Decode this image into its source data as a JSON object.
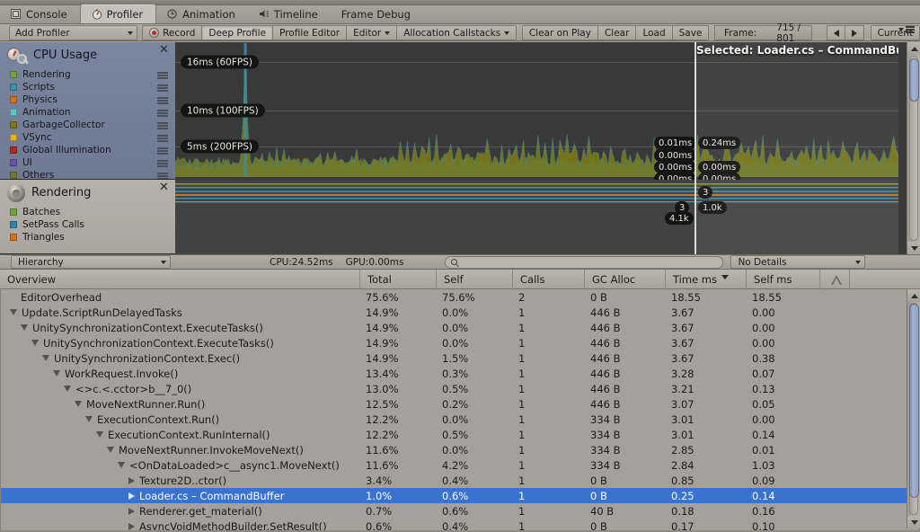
{
  "window": {
    "tabs": [
      {
        "label": "Console",
        "icon": "console-icon",
        "active": false
      },
      {
        "label": "Profiler",
        "icon": "profiler-icon",
        "active": true
      },
      {
        "label": "Animation",
        "icon": "clock-icon",
        "active": false
      },
      {
        "label": "Timeline",
        "icon": "timeline-icon",
        "active": false
      },
      {
        "label": "Frame Debug",
        "icon": "none",
        "active": false
      }
    ]
  },
  "toolbar": {
    "add_profiler": "Add Profiler",
    "record": "Record",
    "deep_profile": "Deep Profile",
    "profile_editor": "Profile Editor",
    "editor": "Editor",
    "allocation_callstacks": "Allocation Callstacks",
    "clear_on_play": "Clear on Play",
    "clear": "Clear",
    "load": "Load",
    "save": "Save",
    "frame_label": "Frame:",
    "frame_value": "715 / 801",
    "current": "Current"
  },
  "modules": [
    {
      "title": "CPU Usage",
      "icon": "cpu-usage-icon",
      "rows": [
        {
          "label": "Rendering",
          "color": "#73a13c"
        },
        {
          "label": "Scripts",
          "color": "#3b90a8"
        },
        {
          "label": "Physics",
          "color": "#d2711f"
        },
        {
          "label": "Animation",
          "color": "#63c6c0"
        },
        {
          "label": "GarbageCollector",
          "color": "#7d7717"
        },
        {
          "label": "VSync",
          "color": "#e3b320"
        },
        {
          "label": "Global Illumination",
          "color": "#ab2b18"
        },
        {
          "label": "UI",
          "color": "#6a52a8"
        },
        {
          "label": "Others",
          "color": "#6f7b2c"
        }
      ]
    },
    {
      "title": "Rendering",
      "icon": "rendering-icon",
      "rows": [
        {
          "label": "Batches",
          "color": "#73a13c"
        },
        {
          "label": "SetPass Calls",
          "color": "#2f87a6"
        },
        {
          "label": "Triangles",
          "color": "#d2711f"
        }
      ]
    }
  ],
  "chart_data": {
    "type": "area",
    "title": "CPU Usage",
    "ylabel": "ms",
    "gridlines": [
      {
        "label": "16ms (60FPS)",
        "value": 16
      },
      {
        "label": "10ms (100FPS)",
        "value": 10
      },
      {
        "label": "5ms (200FPS)",
        "value": 5
      }
    ],
    "ylim": [
      0,
      20
    ],
    "selected_frame_label": "Selected: Loader.cs – CommandBuffer",
    "left_tooltips": [
      "0.01ms",
      "0.00ms",
      "0.00ms",
      "0.00ms"
    ],
    "right_tooltips": [
      "0.24ms",
      "0.00ms",
      "0.00ms"
    ],
    "render_tooltips_left": [
      "3",
      "4.1k"
    ],
    "render_tooltips_right": [
      "3",
      "1.0k"
    ],
    "series": [
      {
        "name": "Others",
        "color": "#6f7b2c"
      },
      {
        "name": "GarbageCollector",
        "color": "#7d7717"
      },
      {
        "name": "Scripts",
        "color": "#3b90a8"
      },
      {
        "name": "Rendering",
        "color": "#73a13c"
      }
    ]
  },
  "hierarchy": {
    "view_mode": "Hierarchy",
    "cpu_time": "CPU:24.52ms",
    "gpu_time": "GPU:0.00ms",
    "search_placeholder": "",
    "details_mode": "No Details",
    "columns": [
      "Overview",
      "Total",
      "Self",
      "Calls",
      "GC Alloc",
      "Time ms",
      "Self ms"
    ],
    "sorted_column": "Time ms",
    "rows": [
      {
        "name": "EditorOverhead",
        "depth": 0,
        "toggle": "none",
        "total": "75.6%",
        "self": "75.6%",
        "calls": "2",
        "gc": "0 B",
        "time": "18.55",
        "selfms": "18.55",
        "selected": false
      },
      {
        "name": "Update.ScriptRunDelayedTasks",
        "depth": 0,
        "toggle": "open",
        "total": "14.9%",
        "self": "0.0%",
        "calls": "1",
        "gc": "446 B",
        "time": "3.67",
        "selfms": "0.00",
        "selected": false
      },
      {
        "name": "UnitySynchronizationContext.ExecuteTasks()",
        "depth": 1,
        "toggle": "open",
        "total": "14.9%",
        "self": "0.0%",
        "calls": "1",
        "gc": "446 B",
        "time": "3.67",
        "selfms": "0.00",
        "selected": false
      },
      {
        "name": "UnitySynchronizationContext.ExecuteTasks()",
        "depth": 2,
        "toggle": "open",
        "total": "14.9%",
        "self": "0.0%",
        "calls": "1",
        "gc": "446 B",
        "time": "3.67",
        "selfms": "0.00",
        "selected": false
      },
      {
        "name": "UnitySynchronizationContext.Exec()",
        "depth": 3,
        "toggle": "open",
        "total": "14.9%",
        "self": "1.5%",
        "calls": "1",
        "gc": "446 B",
        "time": "3.67",
        "selfms": "0.38",
        "selected": false
      },
      {
        "name": "WorkRequest.Invoke()",
        "depth": 4,
        "toggle": "open",
        "total": "13.4%",
        "self": "0.3%",
        "calls": "1",
        "gc": "446 B",
        "time": "3.28",
        "selfms": "0.07",
        "selected": false
      },
      {
        "name": "<>c.<.cctor>b__7_0()",
        "depth": 5,
        "toggle": "open",
        "total": "13.0%",
        "self": "0.5%",
        "calls": "1",
        "gc": "446 B",
        "time": "3.21",
        "selfms": "0.13",
        "selected": false
      },
      {
        "name": "MoveNextRunner.Run()",
        "depth": 6,
        "toggle": "open",
        "total": "12.5%",
        "self": "0.2%",
        "calls": "1",
        "gc": "446 B",
        "time": "3.07",
        "selfms": "0.05",
        "selected": false
      },
      {
        "name": "ExecutionContext.Run()",
        "depth": 7,
        "toggle": "open",
        "total": "12.2%",
        "self": "0.0%",
        "calls": "1",
        "gc": "334 B",
        "time": "3.01",
        "selfms": "0.00",
        "selected": false
      },
      {
        "name": "ExecutionContext.RunInternal()",
        "depth": 8,
        "toggle": "open",
        "total": "12.2%",
        "self": "0.5%",
        "calls": "1",
        "gc": "334 B",
        "time": "3.01",
        "selfms": "0.14",
        "selected": false
      },
      {
        "name": "MoveNextRunner.InvokeMoveNext()",
        "depth": 9,
        "toggle": "open",
        "total": "11.6%",
        "self": "0.0%",
        "calls": "1",
        "gc": "334 B",
        "time": "2.85",
        "selfms": "0.01",
        "selected": false
      },
      {
        "name": "<OnDataLoaded>c__async1.MoveNext()",
        "depth": 10,
        "toggle": "open",
        "total": "11.6%",
        "self": "4.2%",
        "calls": "1",
        "gc": "334 B",
        "time": "2.84",
        "selfms": "1.03",
        "selected": false
      },
      {
        "name": "Texture2D..ctor()",
        "depth": 11,
        "toggle": "closed",
        "total": "3.4%",
        "self": "0.4%",
        "calls": "1",
        "gc": "0 B",
        "time": "0.85",
        "selfms": "0.09",
        "selected": false
      },
      {
        "name": "Loader.cs – CommandBuffer",
        "depth": 11,
        "toggle": "closed",
        "total": "1.0%",
        "self": "0.6%",
        "calls": "1",
        "gc": "0 B",
        "time": "0.25",
        "selfms": "0.14",
        "selected": true
      },
      {
        "name": "Renderer.get_material()",
        "depth": 11,
        "toggle": "closed",
        "total": "0.7%",
        "self": "0.6%",
        "calls": "1",
        "gc": "40 B",
        "time": "0.18",
        "selfms": "0.16",
        "selected": false
      },
      {
        "name": "AsyncVoidMethodBuilder.SetResult()",
        "depth": 11,
        "toggle": "closed",
        "total": "0.6%",
        "self": "0.4%",
        "calls": "1",
        "gc": "0 B",
        "time": "0.17",
        "selfms": "0.10",
        "selected": false
      }
    ]
  }
}
